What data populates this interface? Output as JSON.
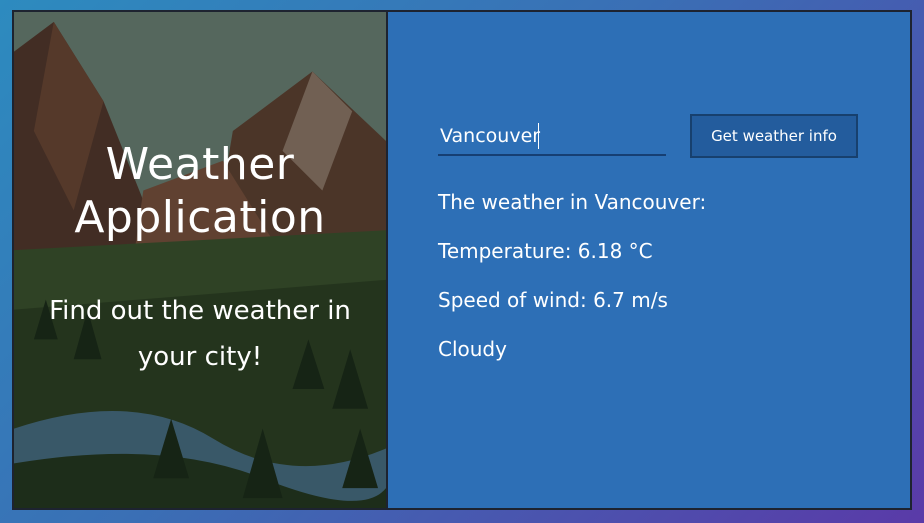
{
  "hero": {
    "title_line1": "Weather",
    "title_line2": "Application",
    "subtitle": "Find out the weather in your city!"
  },
  "search": {
    "city_value": "Vancouver",
    "button_label": "Get weather info"
  },
  "result": {
    "heading": "The weather in Vancouver:",
    "temperature": "Temperature: 6.18 °C",
    "wind": "Speed of wind: 6.7 m/s",
    "condition": "Cloudy"
  },
  "colors": {
    "panel_blue": "#2d6fb6",
    "button_blue": "#235c9d"
  }
}
